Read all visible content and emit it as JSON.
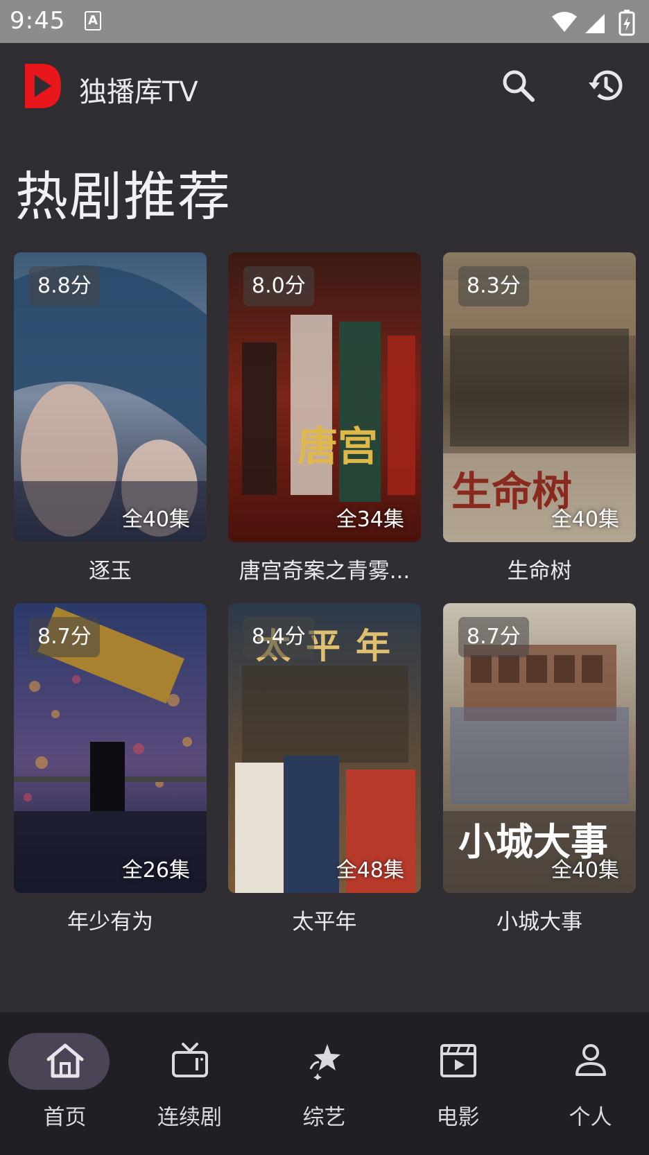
{
  "status_bar": {
    "time": "9:45",
    "notification_icon": "A"
  },
  "app_bar": {
    "title": "独播库TV",
    "logo_icon": "play-logo-icon",
    "search_icon": "search-icon",
    "history_icon": "history-icon"
  },
  "section": {
    "title": "热剧推荐"
  },
  "cards": [
    {
      "rating": "8.8分",
      "episodes": "全40集",
      "title": "逐玉"
    },
    {
      "rating": "8.0分",
      "episodes": "全34集",
      "title": "唐宫奇案之青雾..."
    },
    {
      "rating": "8.3分",
      "episodes": "全40集",
      "title": "生命树"
    },
    {
      "rating": "8.7分",
      "episodes": "全26集",
      "title": "年少有为"
    },
    {
      "rating": "8.4分",
      "episodes": "全48集",
      "title": "太平年"
    },
    {
      "rating": "8.7分",
      "episodes": "全40集",
      "title": "小城大事"
    }
  ],
  "poster_text": {
    "p3": "生命树",
    "p4": "太平年",
    "p6": "小城大事"
  },
  "bottom_nav": [
    {
      "label": "首页",
      "icon": "home-icon",
      "active": true
    },
    {
      "label": "连续剧",
      "icon": "tv-icon",
      "active": false
    },
    {
      "label": "综艺",
      "icon": "star-icon",
      "active": false
    },
    {
      "label": "电影",
      "icon": "clapperboard-icon",
      "active": false
    },
    {
      "label": "个人",
      "icon": "person-icon",
      "active": false
    }
  ],
  "colors": {
    "background": "#302e33",
    "nav_background": "#211f24",
    "nav_active_pill": "#4a4456",
    "logo_red": "#e8161a"
  }
}
